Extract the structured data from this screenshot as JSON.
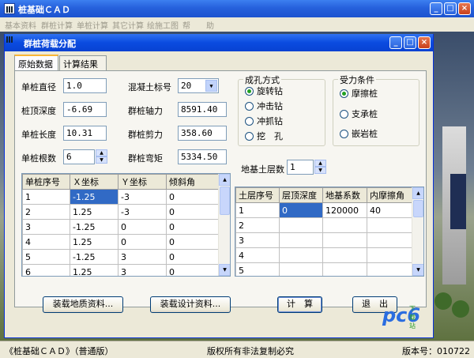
{
  "main_window": {
    "title": "桩基础ＣＡＤ",
    "buttons": {
      "minimize": "_",
      "maximize": "□",
      "close": "×"
    }
  },
  "menu": [
    "基本资料",
    "群桩计算",
    "单桩计算",
    "其它计算",
    "绘施工图",
    "帮　　助"
  ],
  "dialog": {
    "title": "群桩荷载分配",
    "buttons": {
      "minimize": "_",
      "maximize": "□",
      "close": "×"
    },
    "tabs": [
      "原始数据",
      "计算结果"
    ],
    "fields": {
      "diameter_label": "单桩直径",
      "diameter_value": "1.0",
      "top_depth_label": "桩顶深度",
      "top_depth_value": "-6.69",
      "length_label": "单桩长度",
      "length_value": "10.31",
      "count_label": "单桩根数",
      "count_value": "6",
      "concrete_label": "混凝土标号",
      "concrete_value": "20",
      "axial_label": "群桩轴力",
      "axial_value": "8591.40",
      "shear_label": "群桩剪力",
      "shear_value": "358.60",
      "moment_label": "群桩弯矩",
      "moment_value": "5334.50",
      "soil_layers_label": "地基土层数",
      "soil_layers_value": "1"
    },
    "hole_method": {
      "title": "成孔方式",
      "options": [
        "旋转钻",
        "冲击钻",
        "冲抓钻",
        "挖　孔"
      ],
      "selected": 0
    },
    "load_condition": {
      "title": "受力条件",
      "options": [
        "摩擦桩",
        "支承桩",
        "嵌岩桩"
      ],
      "selected": 0
    },
    "pile_table": {
      "headers": [
        "单桩序号",
        "Ｘ坐标",
        "Ｙ坐标",
        "倾斜角"
      ],
      "rows": [
        [
          "1",
          "-1.25",
          "-3",
          "0"
        ],
        [
          "2",
          "1.25",
          "-3",
          "0"
        ],
        [
          "3",
          "-1.25",
          "0",
          "0"
        ],
        [
          "4",
          "1.25",
          "0",
          "0"
        ],
        [
          "5",
          "-1.25",
          "3",
          "0"
        ],
        [
          "6",
          "1.25",
          "3",
          "0"
        ]
      ]
    },
    "soil_table": {
      "headers": [
        "土层序号",
        "层顶深度",
        "地基系数",
        "内摩擦角"
      ],
      "rows": [
        [
          "1",
          "0",
          "120000",
          "40"
        ],
        [
          "2",
          "",
          "",
          ""
        ],
        [
          "3",
          "",
          "",
          ""
        ],
        [
          "4",
          "",
          "",
          ""
        ],
        [
          "5",
          "",
          "",
          ""
        ]
      ]
    },
    "actions": {
      "load_geology": "装载地质资料...",
      "load_design": "装载设计资料...",
      "calculate": "计　算",
      "exit": "退　出"
    }
  },
  "statusbar": {
    "left": "《桩基础ＣＡＤ》（普通版）",
    "center": "版权所有非法复制必究",
    "right": "版本号：010722"
  },
  "watermark": {
    "text": "pc6",
    "sub": "下载站"
  }
}
